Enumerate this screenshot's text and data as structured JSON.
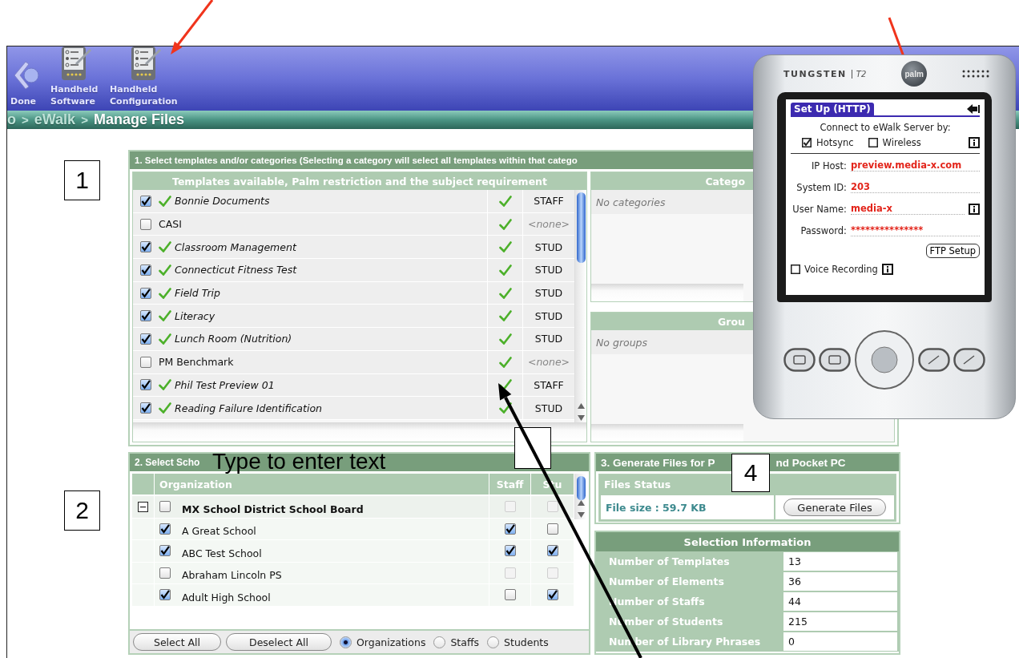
{
  "toolbar": {
    "items": [
      {
        "label": "Done",
        "kind": "back"
      },
      {
        "label": "Handheld Software",
        "kind": "handheld"
      },
      {
        "label": "Handheld Configuration",
        "kind": "handheld"
      }
    ]
  },
  "breadcrumb": {
    "separator": ">",
    "items": [
      {
        "label": "o",
        "selected": false
      },
      {
        "label": "eWalk",
        "selected": false
      },
      {
        "label": "Manage Files",
        "selected": true
      }
    ]
  },
  "section1": {
    "title": "1. Select templates and/or categories (Selecting a category will select all templates within that catego",
    "templates": {
      "header": "Templates available, Palm restriction and the subject requirement",
      "rows": [
        {
          "name": "Bonnie Documents",
          "checked": true,
          "palm_ok": true,
          "requirement": "STAFF",
          "assigned": true
        },
        {
          "name": "CASI",
          "checked": false,
          "palm_ok": true,
          "requirement": "<none>",
          "assigned": false
        },
        {
          "name": "Classroom Management",
          "checked": true,
          "palm_ok": true,
          "requirement": "STUD",
          "assigned": true
        },
        {
          "name": "Connecticut Fitness Test",
          "checked": true,
          "palm_ok": true,
          "requirement": "STUD",
          "assigned": true
        },
        {
          "name": "Field Trip",
          "checked": true,
          "palm_ok": true,
          "requirement": "STUD",
          "assigned": true
        },
        {
          "name": "Literacy",
          "checked": true,
          "palm_ok": true,
          "requirement": "STUD",
          "assigned": true
        },
        {
          "name": "Lunch Room (Nutrition)",
          "checked": true,
          "palm_ok": true,
          "requirement": "STUD",
          "assigned": true
        },
        {
          "name": "PM Benchmark",
          "checked": false,
          "palm_ok": true,
          "requirement": "<none>",
          "assigned": false
        },
        {
          "name": "Phil Test Preview 01",
          "checked": true,
          "palm_ok": true,
          "requirement": "STAFF",
          "assigned": true
        },
        {
          "name": "Reading Failure Identification",
          "checked": true,
          "palm_ok": true,
          "requirement": "STUD",
          "assigned": true
        }
      ]
    },
    "categories": {
      "header": "Catego",
      "empty_text": "No categories"
    },
    "groups": {
      "header": "Grou",
      "empty_text": "No groups"
    }
  },
  "section2": {
    "title": "2. Select Scho",
    "columns": [
      "Organization",
      "Staff",
      "Stu"
    ],
    "tree": [
      {
        "name": "MX School District School Board",
        "expanded": true,
        "checked": false,
        "staff": {
          "checked": false,
          "disabled": true
        },
        "students": {
          "checked": false,
          "disabled": true
        },
        "children": [
          {
            "name": "A Great School",
            "checked": true,
            "staff": {
              "checked": true,
              "disabled": false
            },
            "students": {
              "checked": false,
              "disabled": false
            }
          },
          {
            "name": "ABC Test School",
            "checked": true,
            "staff": {
              "checked": true,
              "disabled": false
            },
            "students": {
              "checked": true,
              "disabled": false
            }
          },
          {
            "name": "Abraham Lincoln PS",
            "checked": false,
            "staff": {
              "checked": false,
              "disabled": true
            },
            "students": {
              "checked": false,
              "disabled": true
            }
          },
          {
            "name": "Adult High School",
            "checked": true,
            "staff": {
              "checked": false,
              "disabled": false
            },
            "students": {
              "checked": true,
              "disabled": false
            }
          }
        ]
      }
    ],
    "buttons": [
      "Select All",
      "Deselect All"
    ],
    "radios": [
      {
        "label": "Organizations",
        "selected": true
      },
      {
        "label": "Staffs",
        "selected": false
      },
      {
        "label": "Students",
        "selected": false
      }
    ]
  },
  "section3": {
    "title_parts": [
      "3. Generate Files for P",
      "nd Pocket PC"
    ],
    "status_header": "Files Status",
    "file_size": "File size : 59.7 KB",
    "button": "Generate Files"
  },
  "selection_info": {
    "title": "Selection Information",
    "rows": [
      {
        "label": "Number of Templates",
        "value": "13"
      },
      {
        "label": "Number of Elements",
        "value": "36"
      },
      {
        "label": "Number of Staffs",
        "value": "44"
      },
      {
        "label": "Number of Students",
        "value": "215"
      },
      {
        "label": "Number of Library Phrases",
        "value": "0"
      }
    ]
  },
  "palm": {
    "brand": "TUNGSTEN",
    "model": "T2",
    "logo": "palm",
    "screen": {
      "title": "Set Up (HTTP)",
      "connect_label": "Connect to eWalk Server by:",
      "options": [
        {
          "label": "Hotsync",
          "checked": true
        },
        {
          "label": "Wireless",
          "checked": false
        }
      ],
      "fields": [
        {
          "label": "IP Host:",
          "value": "preview.media-x.com",
          "info": false
        },
        {
          "label": "System ID:",
          "value": "203",
          "info": false
        },
        {
          "label": "User Name:",
          "value": "media-x",
          "info": true
        },
        {
          "label": "Password:",
          "value": "***************",
          "info": false
        }
      ],
      "button": "FTP Setup",
      "voice": {
        "label": "Voice Recording",
        "checked": false
      }
    }
  },
  "annotations": {
    "callouts": [
      "1",
      "2",
      "4"
    ],
    "overlay_text": "Type to enter text"
  }
}
